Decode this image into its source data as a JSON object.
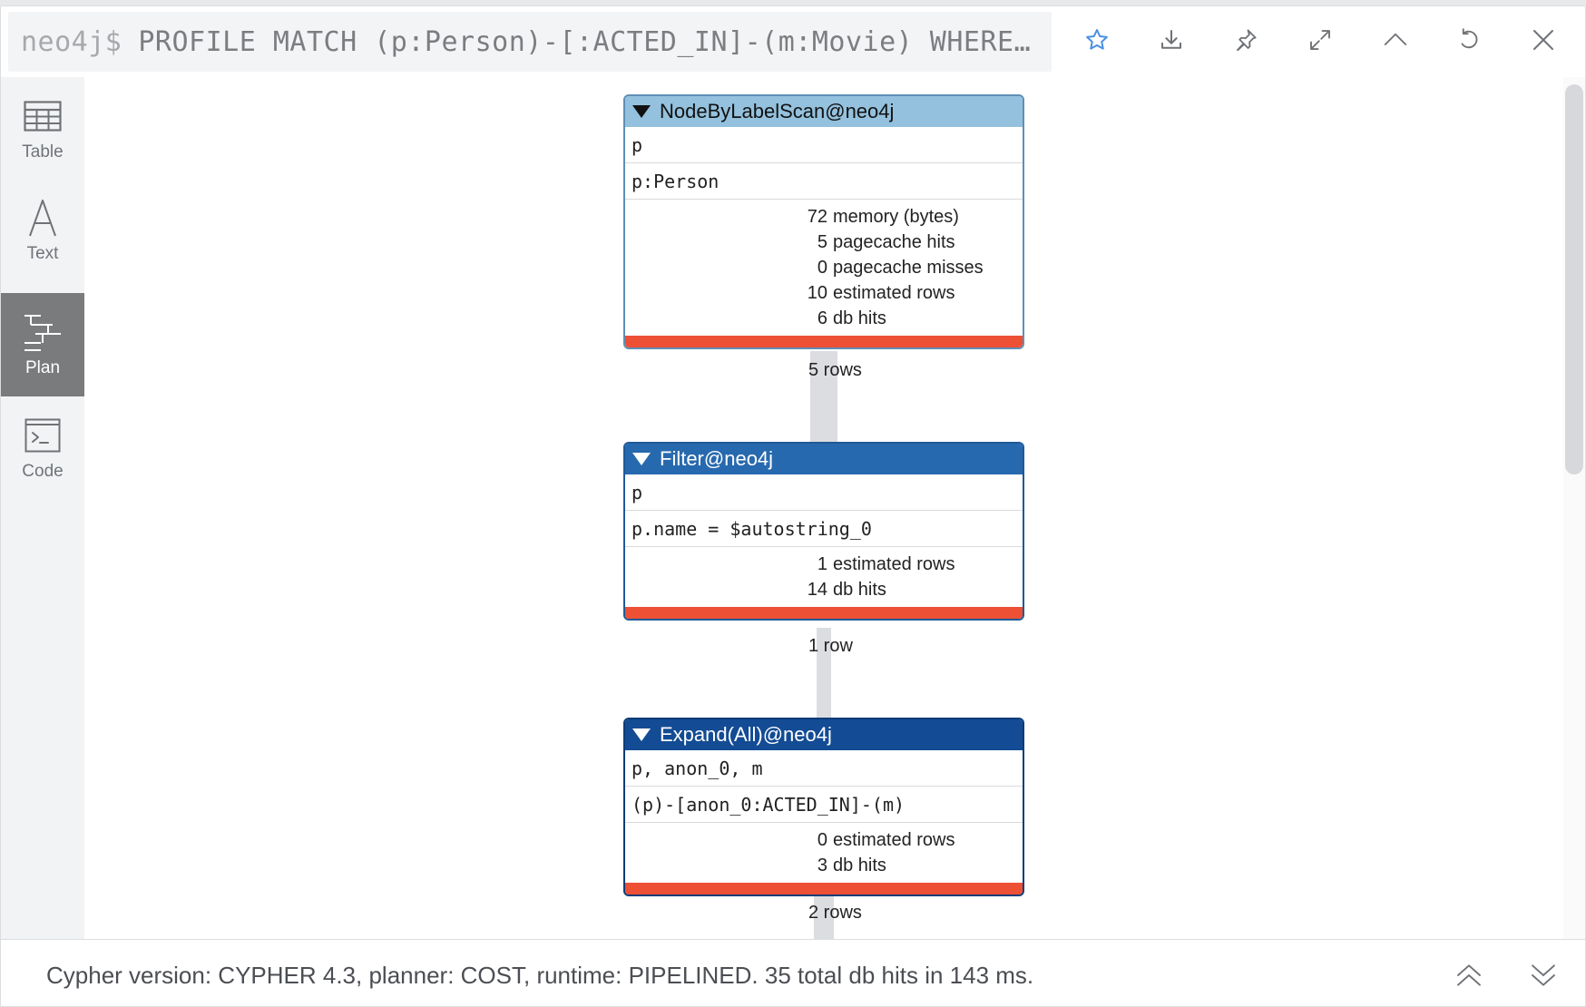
{
  "header": {
    "prompt": "neo4j$",
    "query": "PROFILE MATCH (p:Person)-[:ACTED_IN]-(m:Movie) WHERE…"
  },
  "toolbar": [
    {
      "name": "favorite-button",
      "icon": "star-icon"
    },
    {
      "name": "download-button",
      "icon": "download-icon"
    },
    {
      "name": "pin-button",
      "icon": "pin-icon"
    },
    {
      "name": "fullscreen-button",
      "icon": "expand-icon"
    },
    {
      "name": "collapse-button",
      "icon": "chevron-up-icon"
    },
    {
      "name": "rerun-button",
      "icon": "refresh-icon"
    },
    {
      "name": "close-button",
      "icon": "close-icon"
    }
  ],
  "sidenav": {
    "items": [
      {
        "label": "Table",
        "icon": "table-icon",
        "active": false
      },
      {
        "label": "Text",
        "icon": "text-icon",
        "active": false
      },
      {
        "label": "Plan",
        "icon": "plan-icon",
        "active": true
      },
      {
        "label": "Code",
        "icon": "code-icon",
        "active": false
      }
    ]
  },
  "plan": {
    "operators": [
      {
        "title": "NodeByLabelScan@neo4j",
        "header_color": "#94c1dd",
        "header_text_color": "#111111",
        "identifiers": "p",
        "details": "p:Person",
        "stats": [
          {
            "value": "72",
            "label": "memory (bytes)"
          },
          {
            "value": "5",
            "label": "pagecache hits"
          },
          {
            "value": "0",
            "label": "pagecache misses"
          },
          {
            "value": "10",
            "label": "estimated rows"
          },
          {
            "value": "6",
            "label": "db hits"
          }
        ]
      },
      {
        "title": "Filter@neo4j",
        "header_color": "#2769ae",
        "header_text_color": "#ffffff",
        "identifiers": "p",
        "details": "p.name = $autostring_0",
        "stats": [
          {
            "value": "1",
            "label": "estimated rows"
          },
          {
            "value": "14",
            "label": "db hits"
          }
        ]
      },
      {
        "title": "Expand(All)@neo4j",
        "header_color": "#134b94",
        "header_text_color": "#ffffff",
        "identifiers": "p, anon_0, m",
        "details": "(p)-[anon_0:ACTED_IN]-(m)",
        "stats": [
          {
            "value": "0",
            "label": "estimated rows"
          },
          {
            "value": "3",
            "label": "db hits"
          }
        ]
      }
    ],
    "edges": [
      "5 rows",
      "1 row",
      "2 rows"
    ],
    "profile_bar_color": "#ed5035"
  },
  "footer": {
    "summary": "Cypher version: CYPHER 4.3, planner: COST, runtime: PIPELINED. 35 total db hits in 143 ms."
  }
}
